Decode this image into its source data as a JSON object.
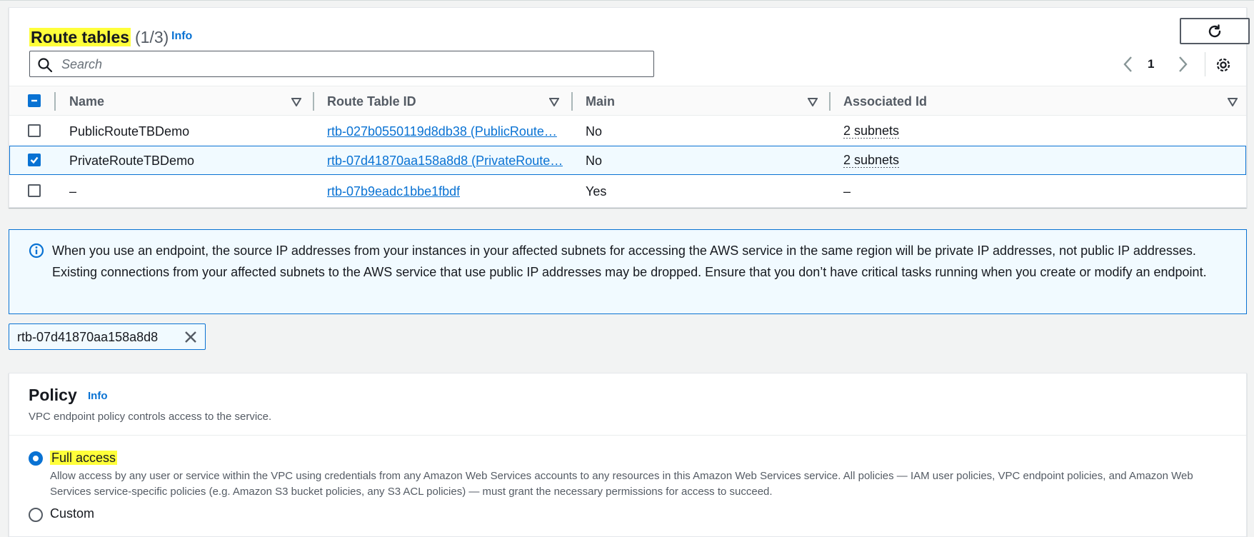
{
  "route_tables": {
    "title": "Route tables",
    "count": "(1/3)",
    "info": "Info",
    "search_placeholder": "Search",
    "page": "1",
    "columns": [
      "Name",
      "Route Table ID",
      "Main",
      "Associated Id"
    ],
    "rows": [
      {
        "name": "PublicRouteTBDemo",
        "id": "rtb-027b0550119d8db38 (PublicRoute…",
        "main": "No",
        "assoc": "2 subnets",
        "selected": false
      },
      {
        "name": "PrivateRouteTBDemo",
        "id": "rtb-07d41870aa158a8d8 (PrivateRoute…",
        "main": "No",
        "assoc": "2 subnets",
        "selected": true
      },
      {
        "name": "–",
        "id": "rtb-07b9eadc1bbe1fbdf",
        "main": "Yes",
        "assoc": "–",
        "selected": false
      }
    ]
  },
  "alert": {
    "text": "When you use an endpoint, the source IP addresses from your instances in your affected subnets for accessing the AWS service in the same region will be private IP addresses, not public IP addresses. Existing connections from your affected subnets to the AWS service that use public IP addresses may be dropped. Ensure that you don’t have critical tasks running when you create or modify an endpoint."
  },
  "token": {
    "label": "rtb-07d41870aa158a8d8"
  },
  "policy": {
    "title": "Policy",
    "info": "Info",
    "description": "VPC endpoint policy controls access to the service.",
    "options": [
      {
        "label": "Full access",
        "description": "Allow access by any user or service within the VPC using credentials from any Amazon Web Services accounts to any resources in this Amazon Web Services service. All policies — IAM user policies, VPC endpoint policies, and Amazon Web Services service-specific policies (e.g. Amazon S3 bucket policies, any S3 ACL policies) — must grant the necessary permissions for access to succeed.",
        "selected": true
      },
      {
        "label": "Custom",
        "selected": false
      }
    ]
  },
  "colors": {
    "accent": "#0972d3",
    "highlight": "#ffff3a",
    "text": "#16191f",
    "muted": "#545b64"
  }
}
